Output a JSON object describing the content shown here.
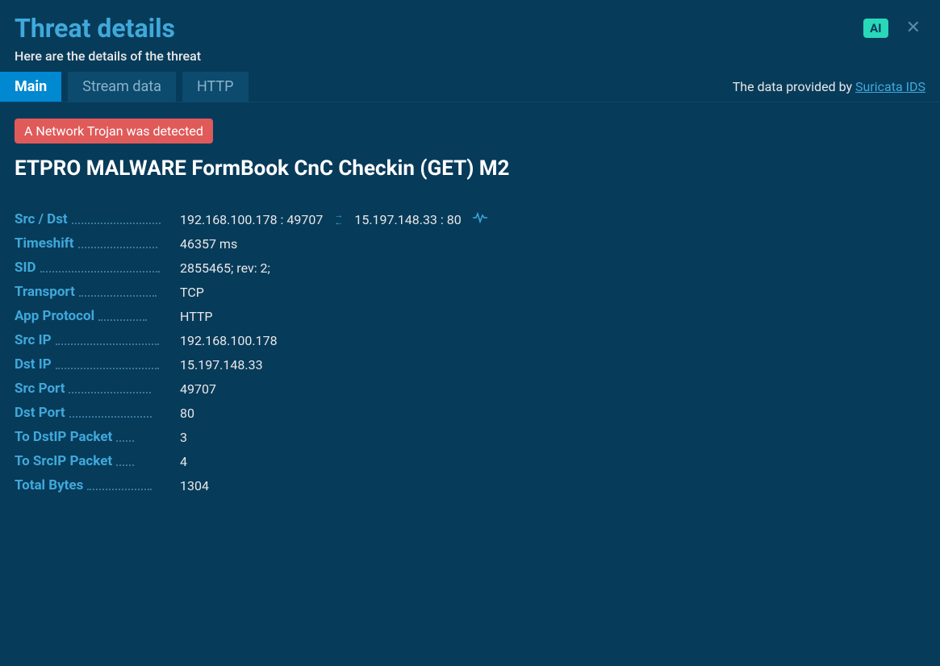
{
  "header": {
    "title": "Threat details",
    "subtitle": "Here are the details of the threat",
    "ai_badge": "AI",
    "close": "✕"
  },
  "tabs": {
    "main": "Main",
    "stream": "Stream data",
    "http": "HTTP"
  },
  "provider": {
    "prefix": "The data provided by ",
    "link": "Suricata IDS"
  },
  "alert": {
    "badge": "A Network Trojan was detected",
    "name": "ETPRO MALWARE FormBook CnC Checkin (GET) M2"
  },
  "fields": {
    "srcdst_label": "Src / Dst",
    "src": "192.168.100.178 : 49707",
    "dst": "15.197.148.33 : 80",
    "timeshift_label": "Timeshift",
    "timeshift": "46357 ms",
    "sid_label": "SID",
    "sid": "2855465; rev: 2;",
    "transport_label": "Transport",
    "transport": "TCP",
    "approtocol_label": "App Protocol",
    "approtocol": "HTTP",
    "srcip_label": "Src IP",
    "srcip": "192.168.100.178",
    "dstip_label": "Dst IP",
    "dstip": "15.197.148.33",
    "srcport_label": "Src Port",
    "srcport": "49707",
    "dstport_label": "Dst Port",
    "dstport": "80",
    "todstip_label": "To DstIP Packet",
    "todstip": "3",
    "tosrcip_label": "To SrcIP Packet",
    "tosrcip": "4",
    "totalbytes_label": "Total Bytes",
    "totalbytes": "1304"
  }
}
